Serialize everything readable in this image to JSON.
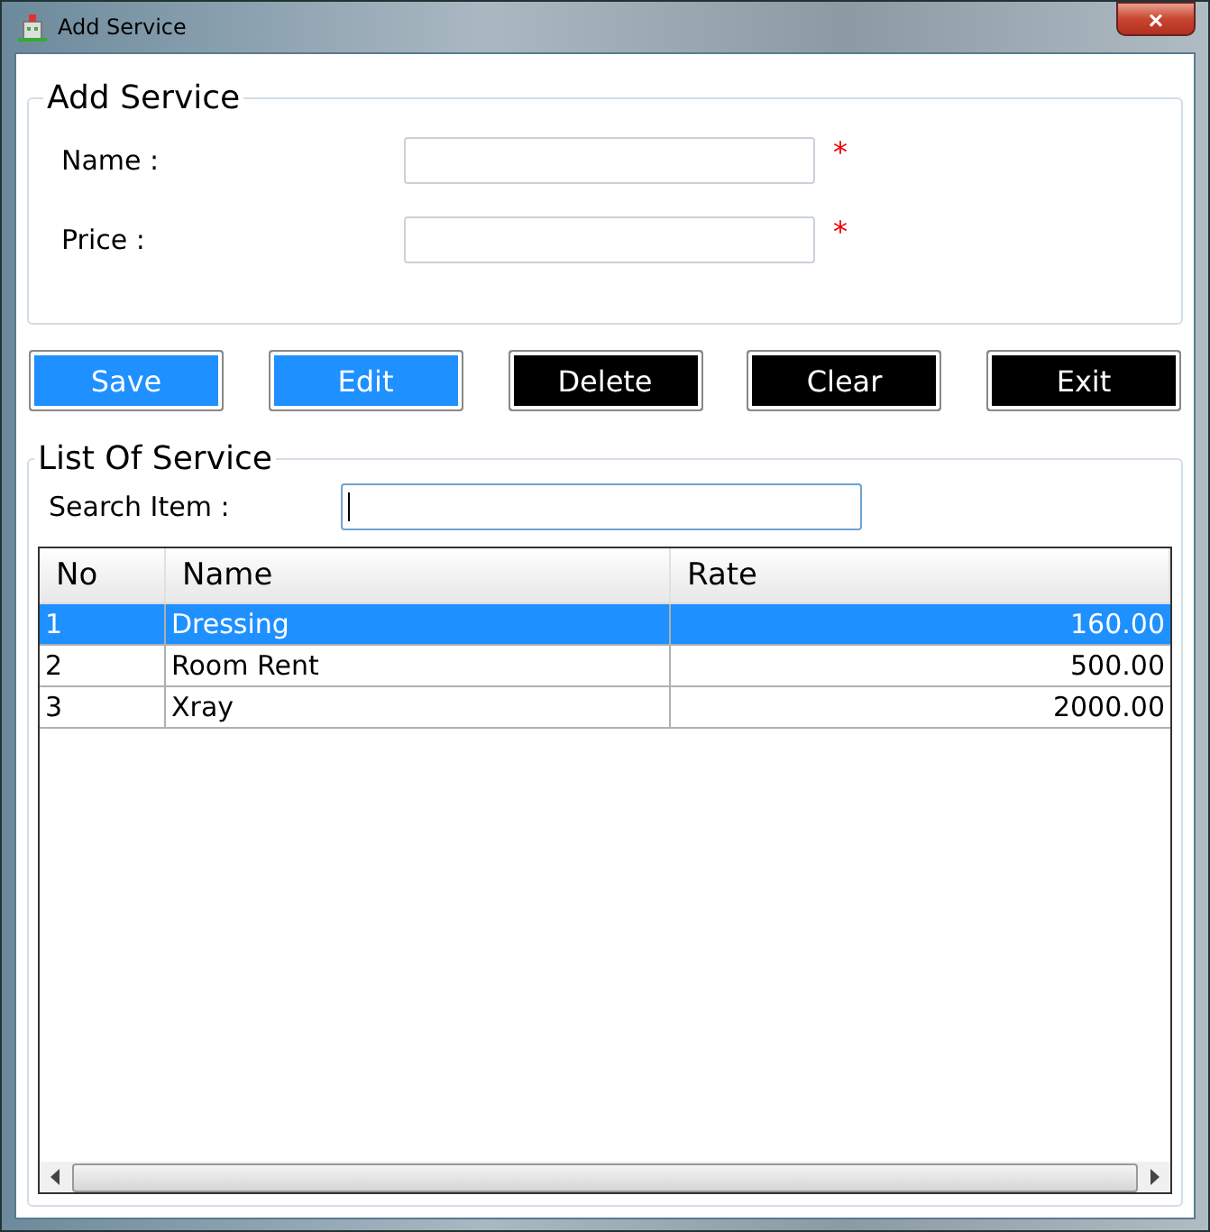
{
  "window": {
    "title": "Add Service",
    "close": "×"
  },
  "form": {
    "legend": "Add Service",
    "fields": [
      {
        "label": "Name :",
        "required": true,
        "required_mark": "*"
      },
      {
        "label": "Price :",
        "required": true,
        "required_mark": "*"
      }
    ]
  },
  "buttons": [
    {
      "label": "Save",
      "color": "#1e90ff"
    },
    {
      "label": "Edit",
      "color": "#1e90ff"
    },
    {
      "label": "Delete",
      "color": "#000000"
    },
    {
      "label": "Clear",
      "color": "#000000"
    },
    {
      "label": "Exit",
      "color": "#000000"
    }
  ],
  "list": {
    "legend": "List Of Service",
    "search": {
      "label": "Search Item :",
      "focused": true
    },
    "columns": [
      "No",
      "Name",
      "Rate"
    ],
    "rows": [
      {
        "no": "1",
        "name": "Dressing",
        "rate": "160.00",
        "selected": true
      },
      {
        "no": "2",
        "name": "Room Rent",
        "rate": "500.00",
        "selected": false
      },
      {
        "no": "3",
        "name": "Xray",
        "rate": "2000.00",
        "selected": false
      }
    ]
  }
}
